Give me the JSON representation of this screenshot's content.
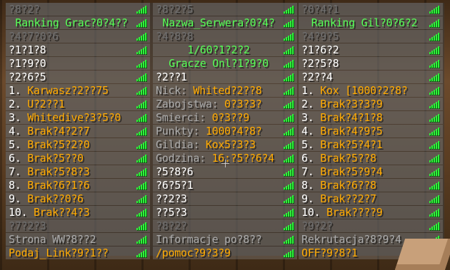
{
  "colors": {
    "green": "#55ff55",
    "gold": "#ffaa00",
    "white": "#ffffff",
    "gray": "#aaaaaa",
    "dark_gray": "#6e6e6e",
    "ping": "#2ff23b"
  },
  "columns": [
    [
      {
        "text": "?8?2?",
        "color": "#6e6e6e"
      },
      {
        "text": "Ranking Grac?0?4??",
        "color": "#55ff55"
      },
      {
        "text": "?4?7?0?6",
        "color": "#6e6e6e"
      },
      {
        "text": "?1?1?8",
        "color": "#ffffff"
      },
      {
        "text": "?1?9?0",
        "color": "#ffffff"
      },
      {
        "text": "?2?6?5",
        "color": "#ffffff"
      },
      {
        "text": "1. Karwasz?2??75",
        "color": "#ffaa00",
        "prefix": "1. "
      },
      {
        "text": "2. U?2??1",
        "color": "#ffaa00",
        "prefix": "2. "
      },
      {
        "text": "3. Whitedive?3?5?0",
        "color": "#ffaa00",
        "prefix": "3. "
      },
      {
        "text": "4. Brak?4?2?7",
        "color": "#ffaa00",
        "prefix": "4. "
      },
      {
        "text": "5. Brak?5?2?0",
        "color": "#ffaa00",
        "prefix": "5. "
      },
      {
        "text": "6. Brak?5??0",
        "color": "#ffaa00",
        "prefix": "6. "
      },
      {
        "text": "7. Brak?5?8?3",
        "color": "#ffaa00",
        "prefix": "7. "
      },
      {
        "text": "8. Brak?6?1?6",
        "color": "#ffaa00",
        "prefix": "8. "
      },
      {
        "text": "9. Brak??0?6",
        "color": "#ffaa00",
        "prefix": "9. "
      },
      {
        "text": "10. Brak??4?3",
        "color": "#ffaa00",
        "prefix": "10. "
      },
      {
        "text": "?7?2?3",
        "color": "#6e6e6e"
      },
      {
        "text": "Strona WW?8??2",
        "color": "#aaaaaa"
      },
      {
        "text": "Podaj_Link?9?1??",
        "color": "#ffaa00"
      }
    ],
    [
      {
        "text": "?8?2?5",
        "color": "#6e6e6e"
      },
      {
        "text": "Nazwa_Serwera?0?4?",
        "color": "#55ff55"
      },
      {
        "text": "?4?8?8",
        "color": "#6e6e6e"
      },
      {
        "text": "1/60?1?2?2",
        "color": "#55ff55"
      },
      {
        "text": "Gracze Onl?1?9?0",
        "color": "#55ff55"
      },
      {
        "text": "?2??1",
        "color": "#ffffff"
      },
      {
        "text": "Nick: Whited?2??8",
        "color": "#ffaa00",
        "prefix": "Nick: "
      },
      {
        "text": "Zabojstwa: 0?3?3?",
        "color": "#ffaa00",
        "prefix": "Zabojstwa: "
      },
      {
        "text": "Smierci: 0?3??9",
        "color": "#ffaa00",
        "prefix": "Smierci: "
      },
      {
        "text": "Punkty: 1000?4?8?",
        "color": "#ffaa00",
        "prefix": "Punkty: "
      },
      {
        "text": "Gildia: Kox5?3?3",
        "color": "#ffaa00",
        "prefix": "Gildia: "
      },
      {
        "text": "Godzina: 16:?5??6?4",
        "color": "#ffaa00",
        "prefix": "Godzina: "
      },
      {
        "text": "?5?8?6",
        "color": "#ffffff"
      },
      {
        "text": "?6?5?1",
        "color": "#ffffff"
      },
      {
        "text": "??2?3",
        "color": "#ffffff"
      },
      {
        "text": "??5?3",
        "color": "#ffffff"
      },
      {
        "text": "?8?2?",
        "color": "#6e6e6e"
      },
      {
        "text": "Informacje po?8??",
        "color": "#aaaaaa"
      },
      {
        "text": "/pomoc?9?3?9",
        "color": "#ffaa00"
      }
    ],
    [
      {
        "text": "?0?4?1",
        "color": "#6e6e6e"
      },
      {
        "text": "Ranking Gil?0?6?2",
        "color": "#55ff55"
      },
      {
        "text": "?4?9?5",
        "color": "#6e6e6e"
      },
      {
        "text": "?1?6?2",
        "color": "#ffffff"
      },
      {
        "text": "?2?5?8",
        "color": "#ffffff"
      },
      {
        "text": "?2??4",
        "color": "#ffffff"
      },
      {
        "text": "1. Kox [1000?2?8?",
        "color": "#ffaa00",
        "prefix": "1. "
      },
      {
        "text": "2. Brak?3?3?9",
        "color": "#ffaa00",
        "prefix": "2. "
      },
      {
        "text": "3. Brak?4?1?8",
        "color": "#ffaa00",
        "prefix": "3. "
      },
      {
        "text": "4. Brak?4?9?5",
        "color": "#ffaa00",
        "prefix": "4. "
      },
      {
        "text": "5. Brak?5?4?1",
        "color": "#ffaa00",
        "prefix": "5. "
      },
      {
        "text": "6. Brak?5??8",
        "color": "#ffaa00",
        "prefix": "6. "
      },
      {
        "text": "7. Brak?5?9?4",
        "color": "#ffaa00",
        "prefix": "7. "
      },
      {
        "text": "8. Brak?6??8",
        "color": "#ffaa00",
        "prefix": "8. "
      },
      {
        "text": "9. Brak??2?7",
        "color": "#ffaa00",
        "prefix": "9. "
      },
      {
        "text": "10. Brak????9",
        "color": "#ffaa00",
        "prefix": "10. "
      },
      {
        "text": "?9?2?",
        "color": "#6e6e6e"
      },
      {
        "text": "Rekrutacja?8?9?4",
        "color": "#aaaaaa"
      },
      {
        "text": "OFF?9?8?1",
        "color": "#ffaa00"
      }
    ]
  ]
}
